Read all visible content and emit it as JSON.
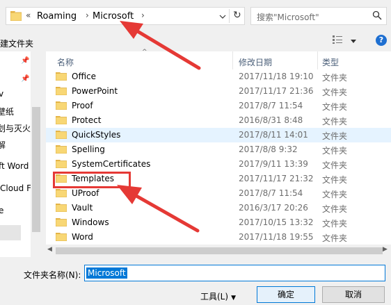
{
  "address_bar": {
    "overflow": "«",
    "crumbs": [
      "Roaming",
      "Microsoft"
    ],
    "separator": "›"
  },
  "search": {
    "placeholder": "搜索\"Microsoft\"",
    "icon": "search-icon"
  },
  "toolbar": {
    "new_folder": "新建文件夹",
    "view_icon": "view-options-icon",
    "help": "?"
  },
  "nav": {
    "items": [
      "v",
      "壁纸",
      "划与灭火",
      "解",
      "ft Word",
      "Cloud F",
      "e"
    ]
  },
  "file_list": {
    "columns": {
      "name": "名称",
      "modified": "修改日期",
      "type": "类型"
    },
    "rows": [
      {
        "name": "Office",
        "date": "2017/11/18 19:10",
        "type": "文件夹"
      },
      {
        "name": "PowerPoint",
        "date": "2017/11/17 21:36",
        "type": "文件夹"
      },
      {
        "name": "Proof",
        "date": "2017/8/7 11:54",
        "type": "文件夹"
      },
      {
        "name": "Protect",
        "date": "2016/8/31 8:48",
        "type": "文件夹"
      },
      {
        "name": "QuickStyles",
        "date": "2017/8/11 14:01",
        "type": "文件夹"
      },
      {
        "name": "Spelling",
        "date": "2017/8/8 9:32",
        "type": "文件夹"
      },
      {
        "name": "SystemCertificates",
        "date": "2017/9/11 13:39",
        "type": "文件夹"
      },
      {
        "name": "Templates",
        "date": "2017/11/17 21:32",
        "type": "文件夹"
      },
      {
        "name": "UProof",
        "date": "2017/8/7 11:54",
        "type": "文件夹"
      },
      {
        "name": "Vault",
        "date": "2016/3/17 20:26",
        "type": "文件夹"
      },
      {
        "name": "Windows",
        "date": "2017/10/15 13:32",
        "type": "文件夹"
      },
      {
        "name": "Word",
        "date": "2017/11/18 19:55",
        "type": "文件夹"
      }
    ],
    "selected_row": "QuickStyles"
  },
  "footer": {
    "folder_name_label": "文件夹名称(N):",
    "folder_name_value": "Microsoft",
    "tools_label": "工具(L)",
    "ok_label": "确定",
    "cancel_label": "取消"
  },
  "colors": {
    "accent": "#0078d7",
    "annotation": "#e53935",
    "folder": "#f8d775",
    "selection": "#e5f3ff"
  }
}
